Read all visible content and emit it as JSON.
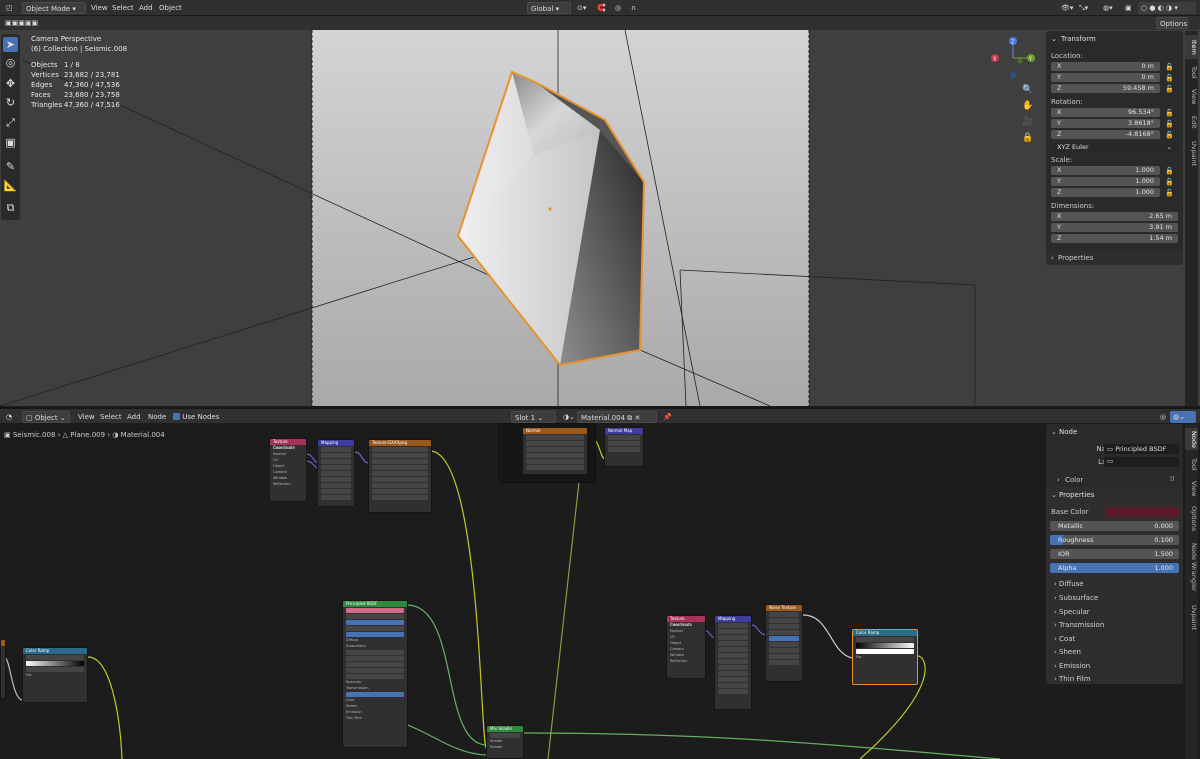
{
  "viewport_header": {
    "mode": "Object Mode",
    "menus": [
      "View",
      "Select",
      "Add",
      "Object"
    ],
    "orientation": "Global",
    "options_label": "Options"
  },
  "viewport_info": {
    "view_name": "Camera Perspective",
    "collection": "(6) Collection | Seismic.008",
    "stats": [
      {
        "label": "Objects",
        "value": "1 / 8"
      },
      {
        "label": "Vertices",
        "value": "23,682 / 23,781"
      },
      {
        "label": "Edges",
        "value": "47,360 / 47,536"
      },
      {
        "label": "Faces",
        "value": "23,680 / 23,758"
      },
      {
        "label": "Triangles",
        "value": "47,360 / 47,516"
      }
    ]
  },
  "transform_panel": {
    "title": "Transform",
    "location_label": "Location:",
    "location": [
      {
        "axis": "X",
        "value": "0 m"
      },
      {
        "axis": "Y",
        "value": "0 m"
      },
      {
        "axis": "Z",
        "value": "59.458 m"
      }
    ],
    "rotation_label": "Rotation:",
    "rotation": [
      {
        "axis": "X",
        "value": "96.534°"
      },
      {
        "axis": "Y",
        "value": "3.8618°"
      },
      {
        "axis": "Z",
        "value": "-4.8168°"
      }
    ],
    "rotation_mode": "XYZ Euler",
    "scale_label": "Scale:",
    "scale": [
      {
        "axis": "X",
        "value": "1.000"
      },
      {
        "axis": "Y",
        "value": "1.000"
      },
      {
        "axis": "Z",
        "value": "1.000"
      }
    ],
    "dimensions_label": "Dimensions:",
    "dimensions": [
      {
        "axis": "X",
        "value": "2.65 m"
      },
      {
        "axis": "Y",
        "value": "3.91 m"
      },
      {
        "axis": "Z",
        "value": "1.54 m"
      }
    ],
    "properties_label": "Properties"
  },
  "viewport_tabs": [
    "Item",
    "Tool",
    "View",
    "Edit",
    "Uvpaint"
  ],
  "node_header": {
    "type": "Object",
    "menus": [
      "View",
      "Select",
      "Add",
      "Node"
    ],
    "use_nodes": "Use Nodes",
    "slot": "Slot 1",
    "material": "Material.004"
  },
  "breadcrumb": [
    "Seismic.008",
    "Plane.009",
    "Material.004"
  ],
  "node_panel": {
    "section": "Node",
    "name_label": "Name",
    "name_value": "Principled BSDF",
    "label_label": "Label",
    "color_label": "Color",
    "properties_label": "Properties",
    "base_color_label": "Base Color",
    "base_color": "#5c1a2a",
    "fields": [
      {
        "label": "Metallic",
        "value": "0.000",
        "fill": 0.0
      },
      {
        "label": "Roughness",
        "value": "0.100",
        "fill": 0.1
      },
      {
        "label": "IOR",
        "value": "1.500",
        "fill": 0.0
      },
      {
        "label": "Alpha",
        "value": "1.000",
        "fill": 1.0
      }
    ],
    "subpanels": [
      "Diffuse",
      "Subsurface",
      "Specular",
      "Transmission",
      "Coat",
      "Sheen",
      "Emission",
      "Thin Film"
    ]
  },
  "node_tabs": [
    "Node",
    "Tool",
    "View",
    "Options",
    "Node Wrangler",
    "Uvpaint"
  ],
  "colors": {
    "accent": "#4772b3",
    "selection": "#e8912d"
  }
}
